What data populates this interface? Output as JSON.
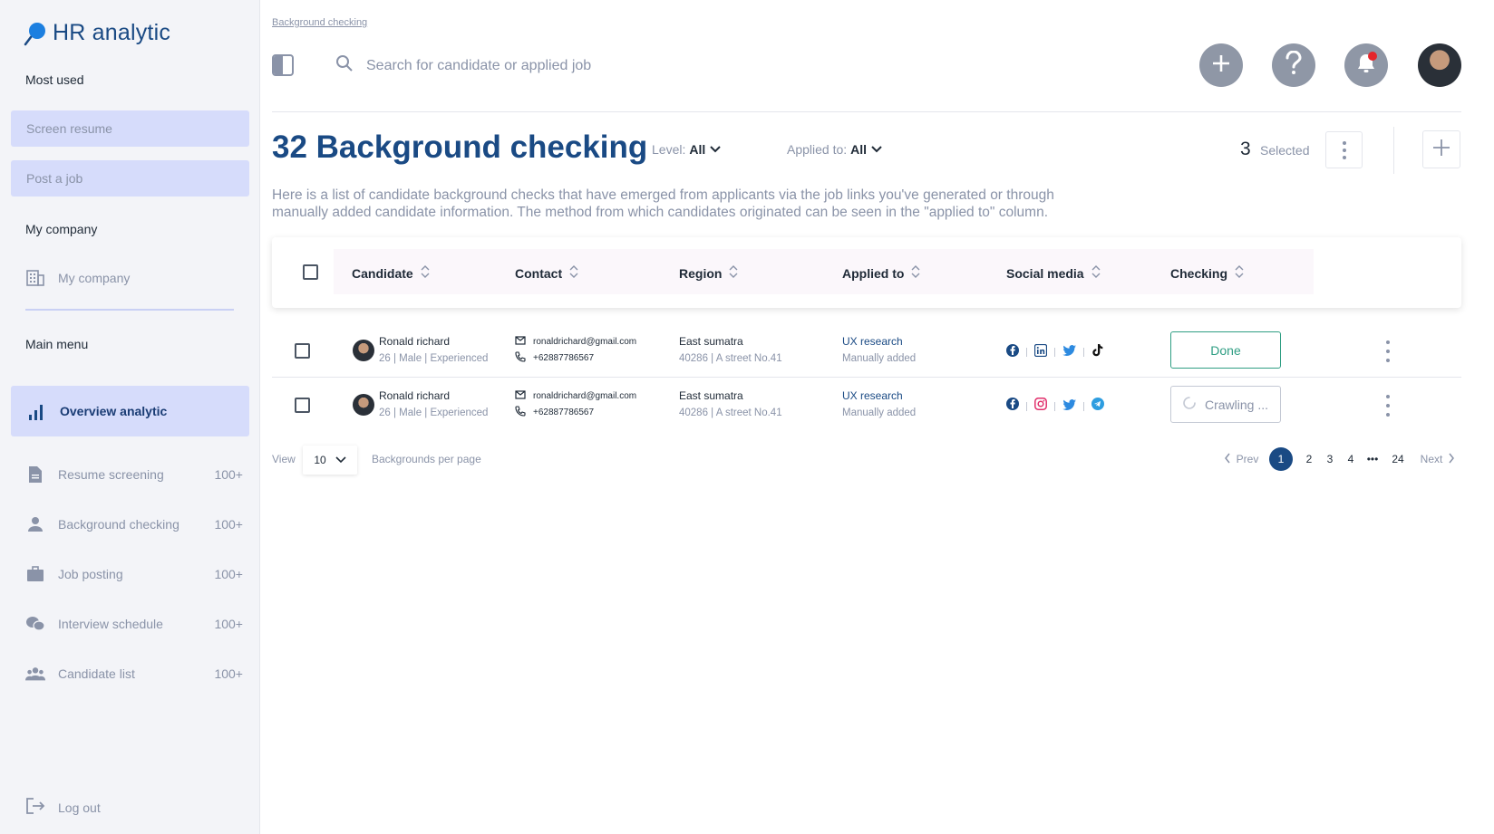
{
  "app": {
    "name": "HR analytic"
  },
  "colors": {
    "brand": "#1a4a84",
    "sidebar_pill": "#d6dcfb",
    "done": "#2f9e83",
    "notification_dot": "#e5262b"
  },
  "sidebar": {
    "most_used_label": "Most used",
    "quick_actions": [
      "Screen resume",
      "Post a job"
    ],
    "my_company_label": "My company",
    "my_company_item": "My company",
    "main_menu_label": "Main menu",
    "active_item": "Overview analytic",
    "items": [
      {
        "label": "Resume screening",
        "count": "100+",
        "icon": "document-icon"
      },
      {
        "label": "Background checking",
        "count": "100+",
        "icon": "person-icon"
      },
      {
        "label": "Job posting",
        "count": "100+",
        "icon": "briefcase-icon"
      },
      {
        "label": "Interview schedule",
        "count": "100+",
        "icon": "chat-bubbles-icon"
      },
      {
        "label": "Candidate list",
        "count": "100+",
        "icon": "group-icon"
      }
    ],
    "logout": "Log out"
  },
  "header": {
    "breadcrumb": "Background checking",
    "search_placeholder": "Search for candidate or applied job"
  },
  "page": {
    "title": "32 Background checking",
    "level_label": "Level:",
    "level_value": "All",
    "applied_label": "Applied to:",
    "applied_value": "All",
    "selected_count": "3",
    "selected_label": "Selected",
    "description": "Here is a list of candidate background checks that have emerged from applicants via the job links you've generated or through manually added candidate information. The method from which candidates originated can be seen in the \"applied to\" column."
  },
  "table": {
    "columns": [
      "Candidate",
      "Contact",
      "Region",
      "Applied to",
      "Social media",
      "Checking"
    ],
    "rows": [
      {
        "name": "Ronald richard",
        "meta": "26 | Male | Experienced",
        "email": "ronaldrichard@gmail.com",
        "phone": "+62887786567",
        "region": "East sumatra",
        "address": "40286 | A street No.41",
        "applied": "UX research",
        "source": "Manually added",
        "social": [
          "facebook-icon",
          "linkedin-icon",
          "twitter-icon",
          "tiktok-icon"
        ],
        "status": "Done"
      },
      {
        "name": "Ronald richard",
        "meta": "26 | Male | Experienced",
        "email": "ronaldrichard@gmail.com",
        "phone": "+62887786567",
        "region": "East sumatra",
        "address": "40286 | A street No.41",
        "applied": "UX research",
        "source": "Manually added",
        "social": [
          "facebook-icon",
          "instagram-icon",
          "twitter-icon",
          "telegram-icon"
        ],
        "status": "Crawling ..."
      }
    ]
  },
  "pagination": {
    "view_label": "View",
    "per_page_value": "10",
    "per_page_label": "Backgrounds per page",
    "prev": "Prev",
    "next": "Next",
    "pages": [
      "1",
      "2",
      "3",
      "4",
      "•••",
      "24"
    ],
    "current": "1"
  }
}
